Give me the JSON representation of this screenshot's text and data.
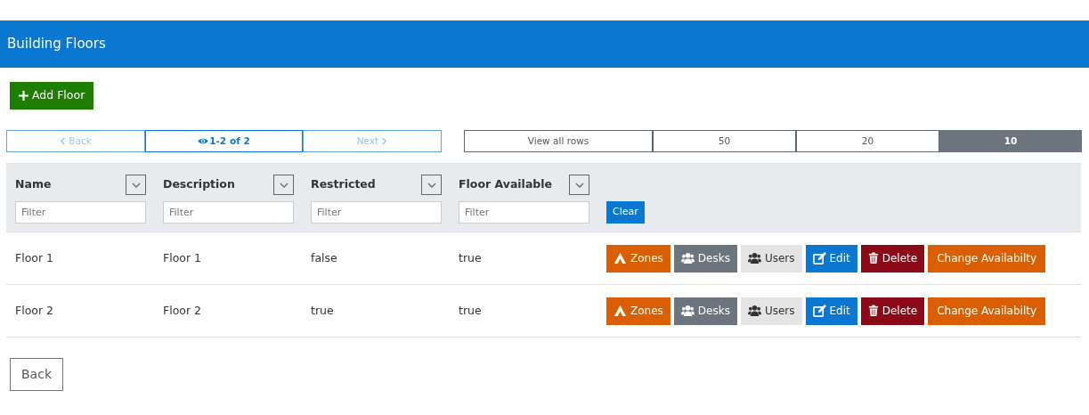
{
  "header": {
    "title": "Building Floors"
  },
  "add_button": {
    "label": "Add Floor"
  },
  "pager": {
    "back": {
      "label": "Back",
      "disabled": true
    },
    "info": {
      "range": "1-2",
      "suffix": "of 2"
    },
    "next": {
      "label": "Next",
      "disabled": true
    }
  },
  "page_sizes": [
    {
      "label": "View all rows",
      "selected": false
    },
    {
      "label": "50",
      "selected": false
    },
    {
      "label": "20",
      "selected": false
    },
    {
      "label": "10",
      "selected": true
    }
  ],
  "table": {
    "columns": [
      {
        "label": "Name",
        "filter_placeholder": "Filter"
      },
      {
        "label": "Description",
        "filter_placeholder": "Filter"
      },
      {
        "label": "Restricted",
        "filter_placeholder": "Filter"
      },
      {
        "label": "Floor Available",
        "filter_placeholder": "Filter"
      }
    ],
    "clear_button": "Clear",
    "rows": [
      {
        "cells": [
          "Floor 1",
          "Floor 1",
          "false",
          "true"
        ],
        "actions": [
          {
            "kind": "zones",
            "label": "Zones"
          },
          {
            "kind": "desks",
            "label": "Desks"
          },
          {
            "kind": "users",
            "label": "Users"
          },
          {
            "kind": "edit",
            "label": "Edit"
          },
          {
            "kind": "delete",
            "label": "Delete"
          },
          {
            "kind": "availability",
            "label": "Change Availabilty"
          }
        ]
      },
      {
        "cells": [
          "Floor 2",
          "Floor 2",
          "true",
          "true"
        ],
        "actions": [
          {
            "kind": "zones",
            "label": "Zones"
          },
          {
            "kind": "desks",
            "label": "Desks"
          },
          {
            "kind": "users",
            "label": "Users"
          },
          {
            "kind": "edit",
            "label": "Edit"
          },
          {
            "kind": "delete",
            "label": "Delete"
          },
          {
            "kind": "availability",
            "label": "Change Availabilty"
          }
        ]
      }
    ]
  },
  "back_button": "Back"
}
